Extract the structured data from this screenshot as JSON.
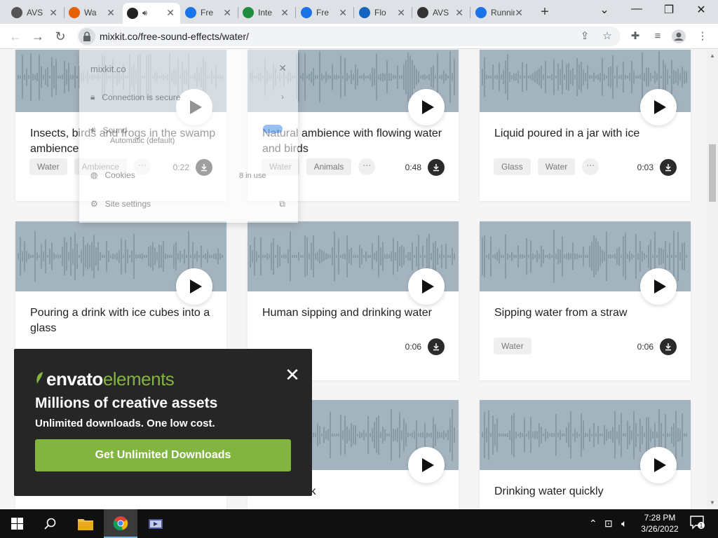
{
  "browser": {
    "tabs": [
      {
        "title": "AVS",
        "favicon": "avs-icon",
        "color": "#555"
      },
      {
        "title": "Wa",
        "favicon": "fox-icon",
        "color": "#e66000"
      },
      {
        "title": "",
        "favicon": "mixkit-icon",
        "color": "#222",
        "active": true
      },
      {
        "title": "Fre",
        "favicon": "play-circle-icon",
        "color": "#1a73e8"
      },
      {
        "title": "Inte",
        "favicon": "play-triangle-icon",
        "color": "#1e8e3e"
      },
      {
        "title": "Fre",
        "favicon": "play-circle-icon",
        "color": "#1a73e8"
      },
      {
        "title": "Flo",
        "favicon": "arrows-icon",
        "color": "#1565c0"
      },
      {
        "title": "AVS",
        "favicon": "avs-icon",
        "color": "#333"
      },
      {
        "title": "Running",
        "favicon": "music-note-icon",
        "color": "#1a73e8"
      }
    ],
    "url": "mixkit.co/free-sound-effects/water/"
  },
  "site_info": {
    "domain": "mixkit.co",
    "connection": "Connection is secure",
    "sound_label": "Sound",
    "sound_value": "Automatic (default)",
    "cookies_label": "Cookies",
    "cookies_value": "8 in use",
    "settings_label": "Site settings"
  },
  "cards": [
    {
      "title": "Insects, birds and frogs in the swamp ambience",
      "tags": [
        "Water",
        "Ambience"
      ],
      "duration": "0:22"
    },
    {
      "title": "Natural ambience with flowing water and birds",
      "tags": [
        "Water",
        "Animals"
      ],
      "duration": "0:48"
    },
    {
      "title": "Liquid poured in a jar with ice",
      "tags": [
        "Glass",
        "Water"
      ],
      "duration": "0:03"
    },
    {
      "title": "Pouring a drink with ice cubes into a glass",
      "tags": [],
      "duration": ""
    },
    {
      "title": "Human sipping and drinking water",
      "tags": [],
      "duration": "0:06"
    },
    {
      "title": "Sipping water from a straw",
      "tags": [
        "Water"
      ],
      "duration": "0:06"
    },
    {
      "title": "",
      "tags": [],
      "duration": ""
    },
    {
      "title": "small drink",
      "tags": [],
      "duration": ""
    },
    {
      "title": "Drinking water quickly",
      "tags": [],
      "duration": ""
    }
  ],
  "envato": {
    "brand_bold": "envato",
    "brand_light": "elements",
    "headline": "Millions of creative assets",
    "subheadline": "Unlimited downloads. One low cost.",
    "cta": "Get Unlimited Downloads",
    "accent": "#82b440"
  },
  "taskbar": {
    "time": "7:28 PM",
    "date": "3/26/2022",
    "notification_count": "1"
  }
}
